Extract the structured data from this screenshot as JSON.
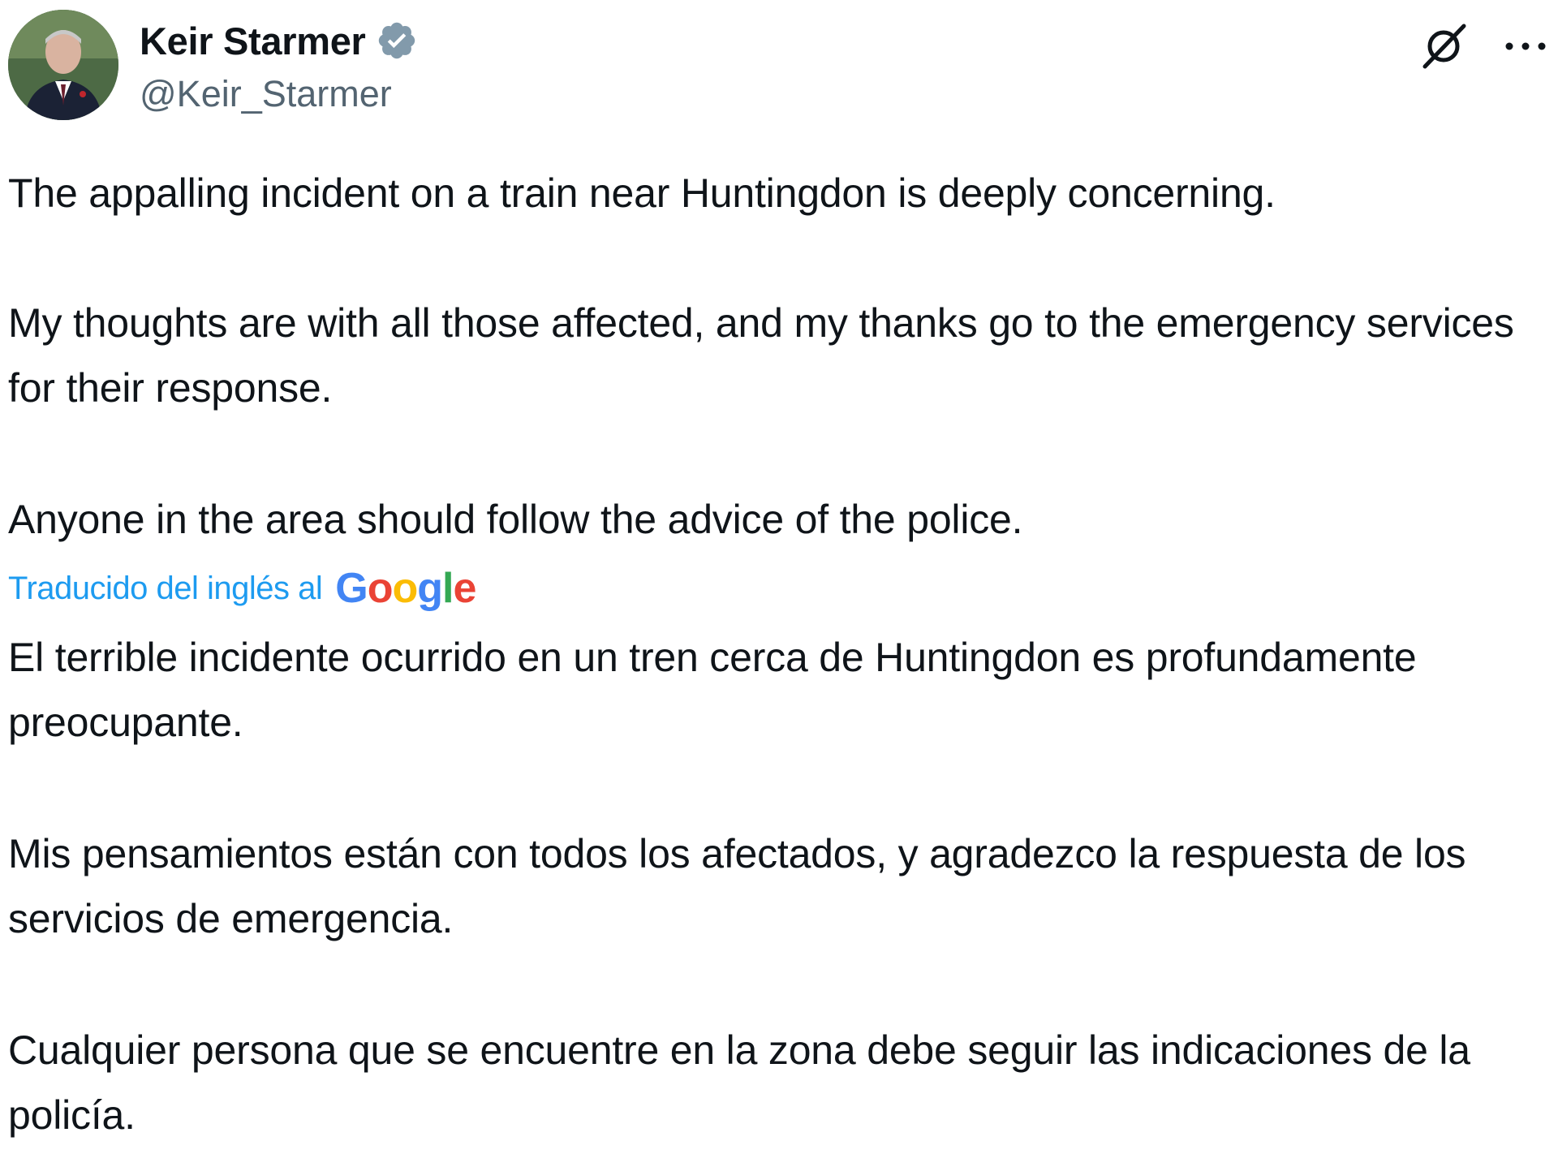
{
  "author": {
    "display_name": "Keir Starmer",
    "handle": "@Keir_Starmer",
    "verified": true
  },
  "icons": {
    "avatar": "profile-photo",
    "verified": "verified-badge-icon",
    "grok": "grok-icon",
    "more": "more-options-icon"
  },
  "tweet": {
    "paragraphs": [
      "The appalling incident on a train near Huntingdon is deeply concerning.",
      "My thoughts are with all those affected, and my thanks go to the emergency services for their response.",
      "Anyone in the area should follow the advice of the police."
    ]
  },
  "translation": {
    "label": "Traducido del inglés al",
    "provider_letters": [
      "G",
      "o",
      "o",
      "g",
      "l",
      "e"
    ],
    "provider_colors": [
      "#4285F4",
      "#EA4335",
      "#FBBC05",
      "#4285F4",
      "#34A853",
      "#EA4335"
    ],
    "paragraphs": [
      "El terrible incidente ocurrido en un tren cerca de Huntingdon es profundamente preocupante.",
      "Mis pensamientos están con todos los afectados, y agradezco la respuesta de los servicios de emergencia.",
      "Cualquier persona que se encuentre en la zona debe seguir las indicaciones de la policía."
    ]
  },
  "colors": {
    "text": "#0f1419",
    "secondary_text": "#536471",
    "link": "#1d9bf0",
    "verified_badge": "#829aab"
  }
}
